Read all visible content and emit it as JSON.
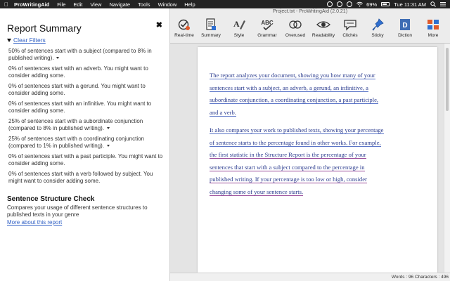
{
  "menubar": {
    "app_name": "ProWritingAid",
    "items": [
      "File",
      "Edit",
      "View",
      "Navigate",
      "Tools",
      "Window",
      "Help"
    ],
    "battery": "69%",
    "clock": "Tue 11:31 AM"
  },
  "window": {
    "title": "Project.txt - ProWritingAid (2.0.21)"
  },
  "report": {
    "title": "Report Summary",
    "clear_filters": "Clear Filters",
    "items": [
      "50% of sentences start with a subject (compared to 8% in published writing).",
      "0% of sentences start with an adverb. You might want to consider adding some.",
      "0% of sentences start with a gerund. You might want to consider adding some.",
      "0% of sentences start with an infinitive. You might want to consider adding some.",
      "25% of sentences start with a subordinate conjunction (compared to 8% in published writing).",
      "25% of sentences start with a coordinating conjunction (compared to 1% in published writing).",
      "0% of sentences start with a past participle. You might want to consider adding some.",
      "0% of sentences start with a verb followed by subject. You might want to consider adding some."
    ],
    "section_title": "Sentence Structure Check",
    "section_desc": "Compares your usage of different sentence structures to published texts in your genre",
    "more_link": "More about this report"
  },
  "toolbar": {
    "items": [
      {
        "label": "Real-time",
        "icon": "realtime-check-icon"
      },
      {
        "label": "Summary",
        "icon": "summary-icon"
      },
      {
        "label": "Style",
        "icon": "style-icon"
      },
      {
        "label": "Grammar",
        "icon": "grammar-icon"
      },
      {
        "label": "Overused",
        "icon": "overused-icon"
      },
      {
        "label": "Readability",
        "icon": "readability-eye-icon"
      },
      {
        "label": "Clichés",
        "icon": "cliches-icon"
      },
      {
        "label": "Sticky",
        "icon": "sticky-icon"
      },
      {
        "label": "Diction",
        "icon": "diction-icon"
      },
      {
        "label": "More",
        "icon": "more-icon"
      }
    ],
    "grammar_glyph": "ABC",
    "diction_glyph": "D"
  },
  "document": {
    "p1_lines": [
      "The report analyzes your document, showing you how many of your",
      "sentences start with a subject, an adverb, a gerund, an infinitive, a",
      "subordinate conjunction, a coordinating conjunction, a past participle,",
      "and a verb."
    ],
    "p2_lines": [
      "It also compares your work to published texts, showing your percentage",
      "of sentence starts to the percentage found in other works. For example,",
      "the first statistic in the Structure Report is the percentage of your",
      "sentences that start with a subject compared to the percentage in",
      "published writing. If your percentage is too low or high, consider",
      "changing some of your sentence starts."
    ]
  },
  "status": {
    "text": "Words : 96 Characters : 496"
  },
  "colors": {
    "link": "#2f5fc4",
    "doc_text": "#2c3d8f",
    "underline_blue": "#5a74c8",
    "underline_purple": "#9b4d9b"
  }
}
